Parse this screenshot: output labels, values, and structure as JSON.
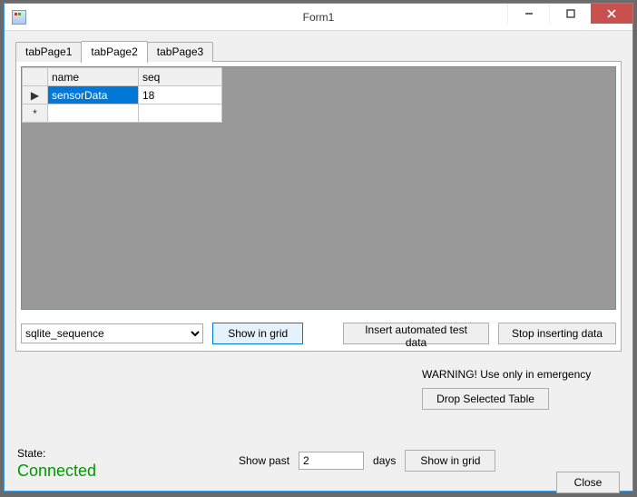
{
  "window": {
    "title": "Form1"
  },
  "tabs": {
    "items": [
      {
        "label": "tabPage1"
      },
      {
        "label": "tabPage2"
      },
      {
        "label": "tabPage3"
      }
    ],
    "activeIndex": 1
  },
  "grid": {
    "columns": {
      "name": "name",
      "seq": "seq"
    },
    "rows": [
      {
        "name": "sensorData",
        "seq": "18"
      }
    ],
    "row_marker": "▶",
    "new_row_marker": "*"
  },
  "controls": {
    "table_select_value": "sqlite_sequence",
    "show_in_grid": "Show in grid",
    "insert_test": "Insert automated test data",
    "stop_insert": "Stop inserting data"
  },
  "warning": {
    "text": "WARNING! Use only in emergency",
    "drop_button": "Drop Selected Table"
  },
  "state": {
    "label": "State:",
    "value": "Connected"
  },
  "showpast": {
    "label": "Show past",
    "days_value": "2",
    "days_label": "days",
    "button": "Show in grid"
  },
  "footer": {
    "close": "Close"
  }
}
